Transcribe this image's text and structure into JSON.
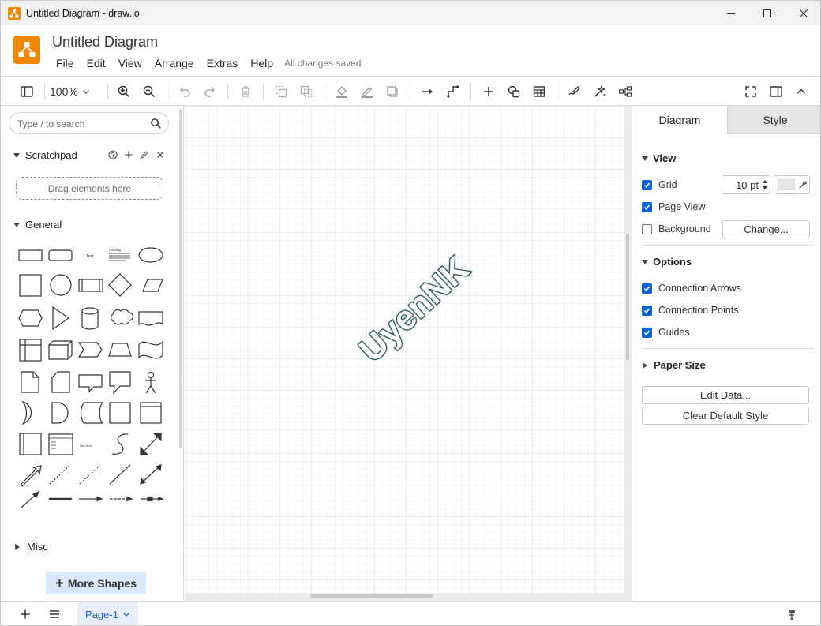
{
  "window": {
    "title": "Untitled Diagram - draw.io"
  },
  "header": {
    "doc_title": "Untitled Diagram",
    "menu": [
      "File",
      "Edit",
      "View",
      "Arrange",
      "Extras",
      "Help"
    ],
    "save_status": "All changes saved"
  },
  "toolbar": {
    "zoom": "100%"
  },
  "left_panel": {
    "search_placeholder": "Type / to search",
    "scratchpad_title": "Scratchpad",
    "dropzone_text": "Drag elements here",
    "general_title": "General",
    "misc_title": "Misc",
    "more_shapes_label": "More Shapes",
    "shape_labels": {
      "text": "Text",
      "heading": "Heading",
      "list_item": "List Item"
    }
  },
  "canvas": {
    "wordart_text": "UyenNK",
    "wordart_stroke": "#1a3a3a",
    "wordart_glow": "#5fa3a0"
  },
  "right_panel": {
    "tabs": [
      "Diagram",
      "Style"
    ],
    "view": {
      "title": "View",
      "grid_label": "Grid",
      "grid_checked": true,
      "grid_size": "10 pt",
      "page_view_label": "Page View",
      "page_view_checked": true,
      "background_label": "Background",
      "background_checked": false,
      "change_label": "Change..."
    },
    "options": {
      "title": "Options",
      "connection_arrows": "Connection Arrows",
      "connection_points": "Connection Points",
      "guides": "Guides"
    },
    "paper_size_title": "Paper Size",
    "edit_data_label": "Edit Data...",
    "clear_style_label": "Clear Default Style"
  },
  "footer": {
    "page_tab": "Page-1"
  },
  "colors": {
    "brand": "#f08705",
    "checkbox": "#0b62d6",
    "more_shapes_bg": "#dae9fc"
  }
}
